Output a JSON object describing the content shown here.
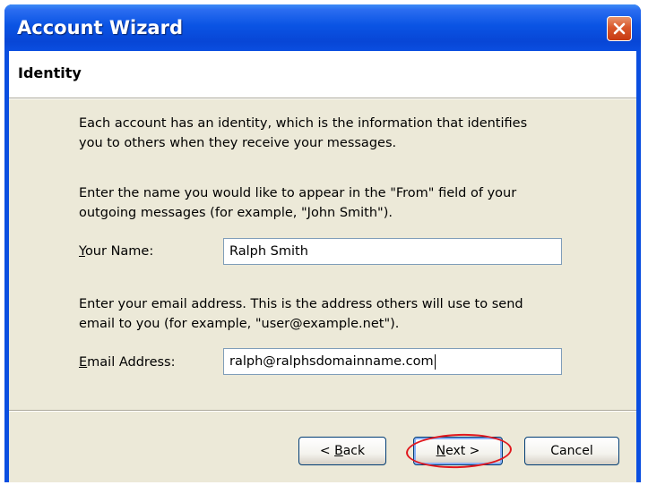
{
  "window": {
    "title": "Account Wizard",
    "close_icon": "close-icon"
  },
  "page": {
    "heading": "Identity",
    "intro_line1": "Each account has an identity, which is the information that identifies",
    "intro_line2": "you to others when they receive your messages.",
    "name_help_line1": "Enter the name you would like to appear in the \"From\" field of your",
    "name_help_line2": "outgoing messages (for example, \"John Smith\").",
    "name_label_accel": "Y",
    "name_label_rest": "our Name:",
    "name_value": "Ralph Smith",
    "email_help_line1": "Enter your email address. This is the address others will use to send",
    "email_help_line2": "email to you (for example, \"user@example.net\").",
    "email_label_accel": "E",
    "email_label_rest": "mail Address:",
    "email_value": "ralph@ralphsdomainname.com"
  },
  "buttons": {
    "back_prefix": "< ",
    "back_accel": "B",
    "back_rest": "ack",
    "next_accel": "N",
    "next_rest": "ext >",
    "cancel": "Cancel"
  },
  "colors": {
    "titlebar": "#0a54e4",
    "close_button": "#d9582c",
    "dialog_face": "#ece9d8",
    "annotation_ring": "#e0181e"
  }
}
